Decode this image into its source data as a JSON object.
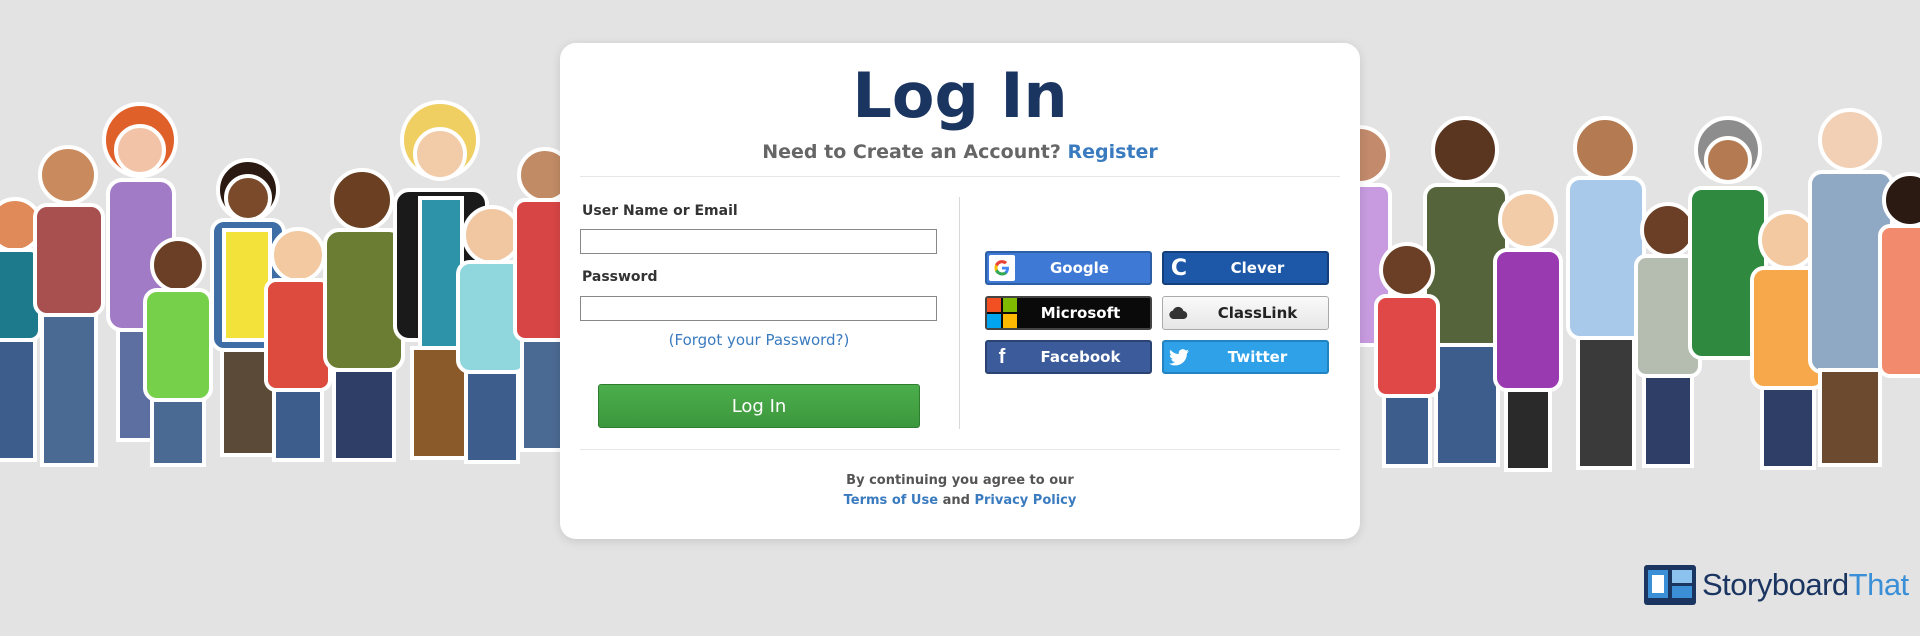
{
  "page": {
    "title": "Log In",
    "subtitle_text": "Need to Create an Account?",
    "register_link": "Register"
  },
  "form": {
    "username_label": "User Name or Email",
    "username_value": "",
    "password_label": "Password",
    "password_value": "",
    "forgot_link": "(Forgot your Password?)",
    "login_button": "Log In"
  },
  "sso": {
    "google": "Google",
    "clever": "Clever",
    "microsoft": "Microsoft",
    "classlink": "ClassLink",
    "facebook": "Facebook",
    "twitter": "Twitter"
  },
  "footer": {
    "agree_text": "By continuing you agree to our",
    "terms_link": "Terms of Use",
    "and_text": "and",
    "privacy_link": "Privacy Policy"
  },
  "logo": {
    "part1": "Storyboard",
    "part2": "That"
  },
  "colors": {
    "title": "#1b3561",
    "link": "#3a7bbf",
    "login_green": "#45a345",
    "background": "#e3e3e3"
  },
  "icons": [
    "google-icon",
    "clever-icon",
    "microsoft-icon",
    "classlink-cloud-icon",
    "facebook-icon",
    "twitter-icon",
    "storyboardthat-logo-icon"
  ]
}
